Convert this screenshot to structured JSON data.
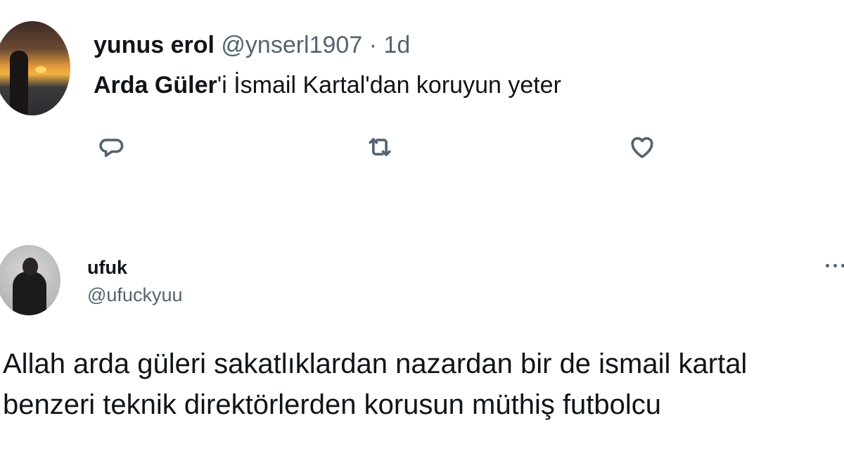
{
  "tweet1": {
    "display_name": "yunus erol",
    "handle": "@ynserl1907",
    "separator": "·",
    "time": "1d",
    "body_bold": "Arda Güler",
    "body_rest": "'i İsmail Kartal'dan koruyun yeter",
    "actions": {
      "reply_icon": "reply-bubble-icon",
      "retweet_icon": "retweet-icon",
      "like_icon": "heart-icon"
    }
  },
  "tweet2": {
    "display_name": "ufuk",
    "handle": "@ufuckyuu",
    "more_icon": "more-dots-icon",
    "body": "Allah arda güleri sakatlıklardan nazardan bir de ismail kartal benzeri teknik direktörlerden korusun müthiş futbolcu"
  },
  "colors": {
    "text_primary": "#0f1419",
    "text_secondary": "#536471",
    "background": "#ffffff"
  }
}
